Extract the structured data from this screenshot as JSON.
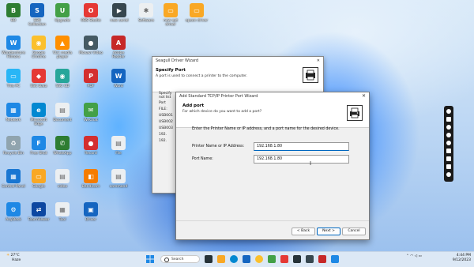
{
  "desktop_icons": [
    {
      "label": "BD",
      "color": "#2e7d32",
      "glyph": "B"
    },
    {
      "label": "SSN Collection",
      "color": "#1565c0",
      "glyph": "S"
    },
    {
      "label": "Upgrade",
      "color": "#43a047",
      "glyph": "U"
    },
    {
      "label": "OBS Studio",
      "color": "#e53935",
      "glyph": "O"
    },
    {
      "label": "new serial",
      "color": "#37474f",
      "glyph": "▶"
    },
    {
      "label": "Software",
      "color": "#eceff1",
      "glyph": "✱"
    },
    {
      "label": "new ept driver",
      "color": "#f9a825",
      "glyph": "▭"
    },
    {
      "label": "epson driver",
      "color": "#f9a825",
      "glyph": "▭"
    },
    {
      "label": "Wondershare Filmora",
      "color": "#1e88e5",
      "glyph": "W"
    },
    {
      "label": "Google Chrome",
      "color": "#fbc02d",
      "glyph": "◉"
    },
    {
      "label": "VLC media player",
      "color": "#ff8f00",
      "glyph": "▲"
    },
    {
      "label": "Movavi Video",
      "color": "#455a64",
      "glyph": "●"
    },
    {
      "label": "Adobe Reader",
      "color": "#c62828",
      "glyph": "A"
    },
    {
      "label": "This PC",
      "color": "#29b6f6",
      "glyph": "▭"
    },
    {
      "label": "SSC Data",
      "color": "#e53935",
      "glyph": "◆"
    },
    {
      "label": "SSC CD",
      "color": "#26a69a",
      "glyph": "◉"
    },
    {
      "label": "PDF",
      "color": "#d32f2f",
      "glyph": "P"
    },
    {
      "label": "Word",
      "color": "#1565c0",
      "glyph": "W"
    },
    {
      "label": "Network",
      "color": "#1e88e5",
      "glyph": "▦"
    },
    {
      "label": "Microsoft Edge",
      "color": "#0288d1",
      "glyph": "e"
    },
    {
      "label": "Document",
      "color": "#eceff1",
      "glyph": "▤"
    },
    {
      "label": "WeChat",
      "color": "#43a047",
      "glyph": "✉"
    },
    {
      "label": "Recycle Bin",
      "color": "#90a4ae",
      "glyph": "♻"
    },
    {
      "label": "Free Shot",
      "color": "#1e88e5",
      "glyph": "F"
    },
    {
      "label": "WhatsApp",
      "color": "#2e7d32",
      "glyph": "✆"
    },
    {
      "label": "Record",
      "color": "#d32f2f",
      "glyph": "●"
    },
    {
      "label": "File",
      "color": "#eceff1",
      "glyph": "▤"
    },
    {
      "label": "Control Panel",
      "color": "#1976d2",
      "glyph": "▦"
    },
    {
      "label": "Google",
      "color": "#f9a825",
      "glyph": "▭"
    },
    {
      "label": "video",
      "color": "#eceff1",
      "glyph": "▤"
    },
    {
      "label": "Bandicam",
      "color": "#f57c00",
      "glyph": "◧"
    },
    {
      "label": "command",
      "color": "#eceff1",
      "glyph": "▤"
    },
    {
      "label": "AnyDesk",
      "color": "#1e88e5",
      "glyph": "⚙"
    },
    {
      "label": "TeamViewer",
      "color": "#0d47a1",
      "glyph": "⇄"
    },
    {
      "label": "Tool",
      "color": "#eceff1",
      "glyph": "▦"
    },
    {
      "label": "Driver",
      "color": "#1565c0",
      "glyph": "▣"
    }
  ],
  "seagull_window": {
    "title": "Seagull Driver Wizard",
    "header_title": "Specify Port",
    "header_subtitle": "A port is used to connect a printer to the computer.",
    "port_items": [
      "Port",
      "FILE:",
      "USB001",
      "USB002",
      "USB003",
      "192.",
      "192."
    ],
    "specify_label": "Specify",
    "specify_sub": "not list"
  },
  "tcp_dialog": {
    "title": "Add Standard TCP/IP Printer Port Wizard",
    "header_title": "Add port",
    "header_subtitle": "For which device do you want to add a port?",
    "instruction": "Enter the Printer Name or IP address, and a port name for the desired device.",
    "printer_label": "Printer Name or IP Address:",
    "printer_value": "192.168.1.80",
    "port_label": "Port Name:",
    "port_value": "192.168.1.80",
    "back_label": "< Back",
    "next_label": "Next >",
    "cancel_label": "Cancel"
  },
  "taskbar": {
    "weather_temp": "27°C",
    "weather_desc": "Haze",
    "search_label": "Search",
    "time": "4:44 PM",
    "date": "9/12/2023"
  }
}
